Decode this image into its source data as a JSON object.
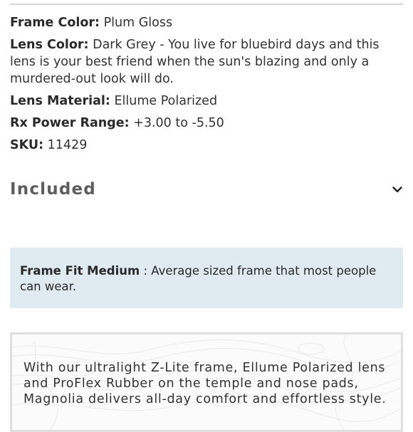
{
  "specs": [
    {
      "label": "Frame Color:",
      "value": "Plum Gloss"
    },
    {
      "label": "Lens Color:",
      "value": "Dark Grey - You live for bluebird days and this lens is your best friend when the sun's blazing and only a murdered-out look will do."
    },
    {
      "label": "Lens Material:",
      "value": "Ellume Polarized"
    },
    {
      "label": "Rx Power Range:",
      "value": "+3.00 to -5.50"
    },
    {
      "label": "SKU:",
      "value": "11429"
    }
  ],
  "included": {
    "title": "Included",
    "icon": "chevron-down-icon"
  },
  "frame_fit": {
    "label": "Frame Fit Medium",
    "separator": " : ",
    "text": "Average sized frame that most people can wear."
  },
  "description": {
    "text": "With our ultralight Z-Lite frame, Ellume Polarized lens and ProFlex Rubber on the temple and nose pads, Magnolia delivers all-day comfort and effortless style."
  },
  "colors": {
    "fit_box_bg": "#dfeaf1",
    "divider": "#d6d6d6"
  }
}
